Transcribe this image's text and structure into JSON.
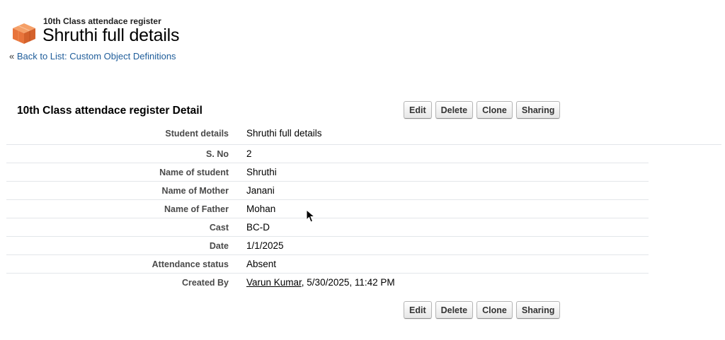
{
  "header": {
    "object_type": "10th Class attendace register",
    "record_title": "Shruthi full details",
    "back_prefix": "« ",
    "back_link": "Back to List: Custom Object Definitions",
    "icon": "cube-icon"
  },
  "detail": {
    "title": "10th Class attendace register Detail",
    "buttons": {
      "edit": "Edit",
      "delete": "Delete",
      "clone": "Clone",
      "sharing": "Sharing"
    },
    "fields": [
      {
        "label": "Student details",
        "value": "Shruthi full details"
      },
      {
        "label": "S. No",
        "value": "2"
      },
      {
        "label": "Name of student",
        "value": "Shruthi"
      },
      {
        "label": "Name of Mother",
        "value": "Janani"
      },
      {
        "label": "Name of Father",
        "value": "Mohan"
      },
      {
        "label": "Cast",
        "value": "BC-D"
      },
      {
        "label": "Date",
        "value": "1/1/2025"
      },
      {
        "label": "Attendance status",
        "value": "Absent"
      }
    ],
    "created_by": {
      "label": "Created By",
      "user": "Varun Kumar",
      "timestamp": ", 5/30/2025, 11:42 PM"
    }
  },
  "colors": {
    "link": "#1f5d9a",
    "icon": "#e8743b",
    "separator": "#e3e6ea"
  }
}
